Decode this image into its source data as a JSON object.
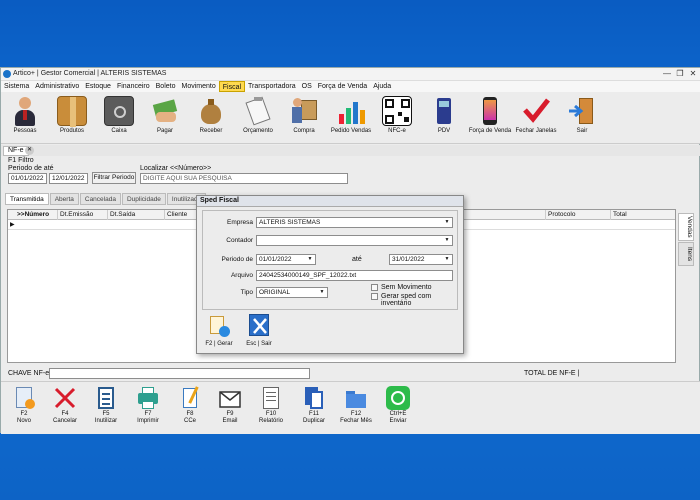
{
  "window": {
    "title": "Artico+ | Gestor Comercial | ALTERIS SISTEMAS"
  },
  "menu": [
    "Sistema",
    "Administrativo",
    "Estoque",
    "Financeiro",
    "Boleto",
    "Movimento",
    "Fiscal",
    "Transportadora",
    "OS",
    "Força de Venda",
    "Ajuda"
  ],
  "toolbar": [
    {
      "label": "Pessoas",
      "icon": "people-icon"
    },
    {
      "label": "Produtos",
      "icon": "box-icon"
    },
    {
      "label": "Caixa",
      "icon": "safe-icon"
    },
    {
      "label": "Pagar",
      "icon": "money-hand-icon"
    },
    {
      "label": "Receber",
      "icon": "money-bag-icon"
    },
    {
      "label": "Orçamento",
      "icon": "clipboard-icon"
    },
    {
      "label": "Compra",
      "icon": "trolley-icon"
    },
    {
      "label": "Pedido Vendas",
      "icon": "chart-icon"
    },
    {
      "label": "NFC-e",
      "icon": "qr-code-icon"
    },
    {
      "label": "PDV",
      "icon": "card-terminal-icon"
    },
    {
      "label": "Força de Venda",
      "icon": "smartphone-icon"
    },
    {
      "label": "Fechar Janelas",
      "icon": "checkmark-icon"
    },
    {
      "label": "Sair",
      "icon": "exit-door-icon"
    }
  ],
  "doc_tab": "NF-e",
  "filter": {
    "section": "F1 Filtro",
    "periodo_label": "Periodo de  até",
    "date_from": "01/01/2022",
    "date_to": "12/01/2022",
    "filter_button": "Filtrar Periodo",
    "localizar_label": "Localizar <<Número>>",
    "search_value": "DIGITE AQUI SUA PESQUISA"
  },
  "grid_tabs": [
    "Transmitida",
    "Aberta",
    "Cancelada",
    "Duplicidade",
    "Inutilizada"
  ],
  "grid_columns": [
    ">>Número",
    "Dt.Emissão",
    "Dt.Saída",
    "Cliente",
    "Protocolo",
    "Total"
  ],
  "side_tabs": [
    "Vendas",
    "Itens"
  ],
  "chave_label": "CHAVE NF-e:",
  "total_label": "TOTAL DE NF-E  |",
  "bottom": [
    {
      "key": "F2",
      "label": "Novo",
      "icon": "new-document-icon"
    },
    {
      "key": "F4",
      "label": "Cancelar",
      "icon": "cancel-x-icon"
    },
    {
      "key": "F5",
      "label": "Inutilizar",
      "icon": "checklist-icon"
    },
    {
      "key": "F7",
      "label": "Imprimir",
      "icon": "printer-icon"
    },
    {
      "key": "F8",
      "label": "CCe",
      "icon": "correction-letter-icon"
    },
    {
      "key": "F9",
      "label": "Email",
      "icon": "envelope-icon"
    },
    {
      "key": "F10",
      "label": "Relatório",
      "icon": "report-icon"
    },
    {
      "key": "F11",
      "label": "Duplicar",
      "icon": "duplicate-icon"
    },
    {
      "key": "F12",
      "label": "Fechar Mês",
      "icon": "folder-icon"
    },
    {
      "key": "Ctrl+E",
      "label": "Enviar",
      "icon": "whatsapp-icon"
    }
  ],
  "dialog": {
    "title": "Sped Fiscal",
    "empresa_label": "Empresa",
    "empresa_value": "ALTERIS SISTEMAS",
    "contador_label": "Contador",
    "contador_value": "",
    "periodo_label": "Periodo de",
    "date_from": "01/01/2022",
    "ate_label": "até",
    "date_to": "31/01/2022",
    "arquivo_label": "Arquivo",
    "arquivo_value": "24042534000149_SPF_12022.txt",
    "tipo_label": "Tipo",
    "tipo_value": "ORIGINAL",
    "chk_sem_movimento": "Sem Movimento",
    "chk_inventario": "Gerar sped com inventário",
    "btn_gerar": "F2 | Gerar",
    "btn_sair": "Esc | Sair"
  }
}
